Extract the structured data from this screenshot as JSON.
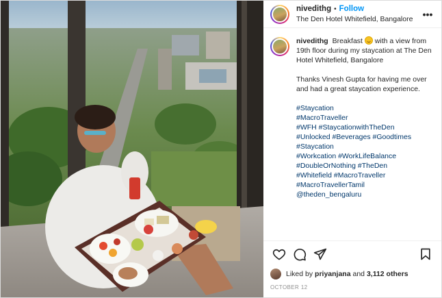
{
  "post": {
    "username": "nivedithg",
    "dot": "•",
    "follow_label": "Follow",
    "location": "The Den Hotel Whitefield, Bangalore",
    "more_label": "•••"
  },
  "caption": {
    "username": "nivedithg",
    "text_before_emoji": "Breakfast",
    "text_after_emoji": "with a view from 19th floor during my staycation at The Den Hotel Whitefield, Bangalore",
    "thanks": "Thanks Vinesh Gupta for having me over and had a great staycation experience.",
    "hashtags": [
      "#Staycation",
      "#MacroTraveller",
      "#WFH #StaycationwithTheDen",
      "#Unlocked #Beverages #Goodtimes",
      "#Staycation",
      "#Workcation #WorkLifeBalance",
      "#DoubleOrNothing #TheDen",
      "#Whitefield #MacroTraveller",
      "#MacroTravellerTamil",
      "@theden_bengaluru"
    ]
  },
  "likes": {
    "prefix": "Liked by",
    "user": "priyanjana",
    "and": "and",
    "count": "3,112 others"
  },
  "date": "OCTOBER 12",
  "icons": {
    "like": "heart-icon",
    "comment": "comment-icon",
    "share": "share-icon",
    "save": "bookmark-icon",
    "more": "more-options-icon"
  },
  "colors": {
    "follow": "#0095f6",
    "hashtag": "#00376b",
    "meta": "#8e8e8e"
  }
}
